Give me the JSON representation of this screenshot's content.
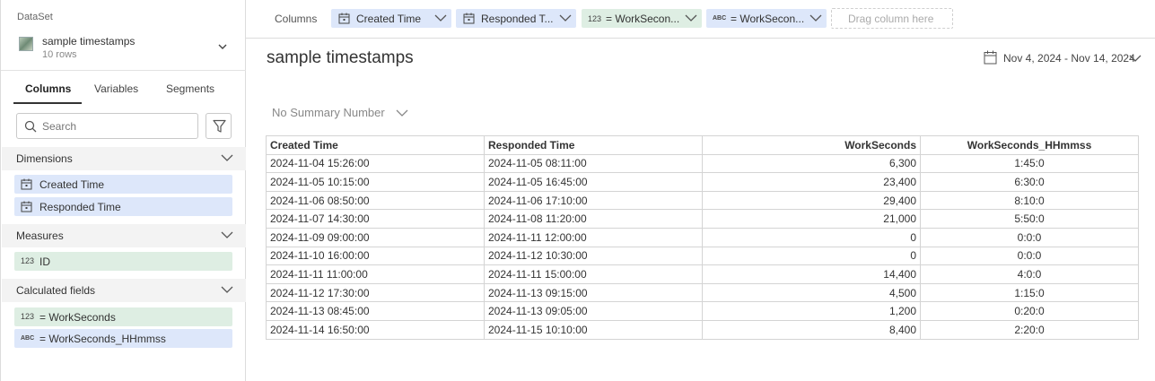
{
  "sidebar": {
    "dataset_label": "DataSet",
    "dataset_name": "sample timestamps",
    "dataset_rows": "10 rows",
    "tabs": [
      {
        "label": "Columns"
      },
      {
        "label": "Variables"
      },
      {
        "label": "Segments"
      }
    ],
    "search_placeholder": "Search",
    "sections": {
      "dimensions": {
        "label": "Dimensions",
        "items": [
          {
            "label": "Created Time"
          },
          {
            "label": "Responded Time"
          }
        ]
      },
      "measures": {
        "label": "Measures",
        "items": [
          {
            "tag": "123",
            "label": "ID"
          }
        ]
      },
      "calculated": {
        "label": "Calculated fields",
        "items": [
          {
            "tag": "123",
            "label": "= WorkSeconds"
          },
          {
            "tag": "ABC",
            "label": "= WorkSeconds_HHmmss"
          }
        ]
      }
    }
  },
  "columns_bar": {
    "label": "Columns",
    "pills": [
      {
        "label": "Created Time"
      },
      {
        "label": "Responded T..."
      },
      {
        "tag": "123",
        "label": "= WorkSecon..."
      },
      {
        "tag": "ABC",
        "label": "= WorkSecon..."
      }
    ],
    "drop_text": "Drag column here"
  },
  "main": {
    "title": "sample timestamps",
    "date_range": "Nov 4, 2024 - Nov 14, 2024",
    "summary": "No Summary Number",
    "table": {
      "headers": [
        "Created Time",
        "Responded Time",
        "WorkSeconds",
        "WorkSeconds_HHmmss"
      ],
      "rows": [
        [
          "2024-11-04 15:26:00",
          "2024-11-05 08:11:00",
          "6,300",
          "1:45:0"
        ],
        [
          "2024-11-05 10:15:00",
          "2024-11-05 16:45:00",
          "23,400",
          "6:30:0"
        ],
        [
          "2024-11-06 08:50:00",
          "2024-11-06 17:10:00",
          "29,400",
          "8:10:0"
        ],
        [
          "2024-11-07 14:30:00",
          "2024-11-08 11:20:00",
          "21,000",
          "5:50:0"
        ],
        [
          "2024-11-09 09:00:00",
          "2024-11-11 12:00:00",
          "0",
          "0:0:0"
        ],
        [
          "2024-11-10 16:00:00",
          "2024-11-12 10:30:00",
          "0",
          "0:0:0"
        ],
        [
          "2024-11-11 11:00:00",
          "2024-11-11 15:00:00",
          "14,400",
          "4:0:0"
        ],
        [
          "2024-11-12 17:30:00",
          "2024-11-13 09:15:00",
          "4,500",
          "1:15:0"
        ],
        [
          "2024-11-13 08:45:00",
          "2024-11-13 09:05:00",
          "1,200",
          "0:20:0"
        ],
        [
          "2024-11-14 16:50:00",
          "2024-11-15 10:10:00",
          "8,400",
          "2:20:0"
        ]
      ]
    }
  },
  "colors": {
    "dimension_bg": "#dde7fa",
    "measure_bg": "#deeee3",
    "border": "#d4d4d4"
  }
}
